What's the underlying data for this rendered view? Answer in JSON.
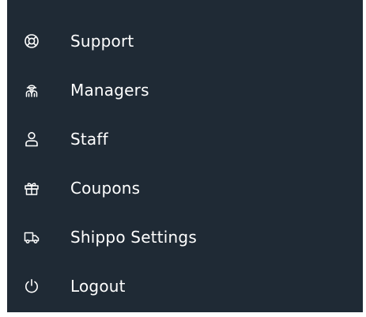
{
  "menu": {
    "items": [
      {
        "label": "Support",
        "icon": "lifebuoy-icon"
      },
      {
        "label": "Managers",
        "icon": "managers-icon"
      },
      {
        "label": "Staff",
        "icon": "user-icon"
      },
      {
        "label": "Coupons",
        "icon": "gift-icon"
      },
      {
        "label": "Shippo Settings",
        "icon": "truck-icon"
      },
      {
        "label": "Logout",
        "icon": "power-icon"
      }
    ]
  },
  "colors": {
    "background": "#1f2a35",
    "text": "#ffffff",
    "icon": "#ffffff"
  }
}
